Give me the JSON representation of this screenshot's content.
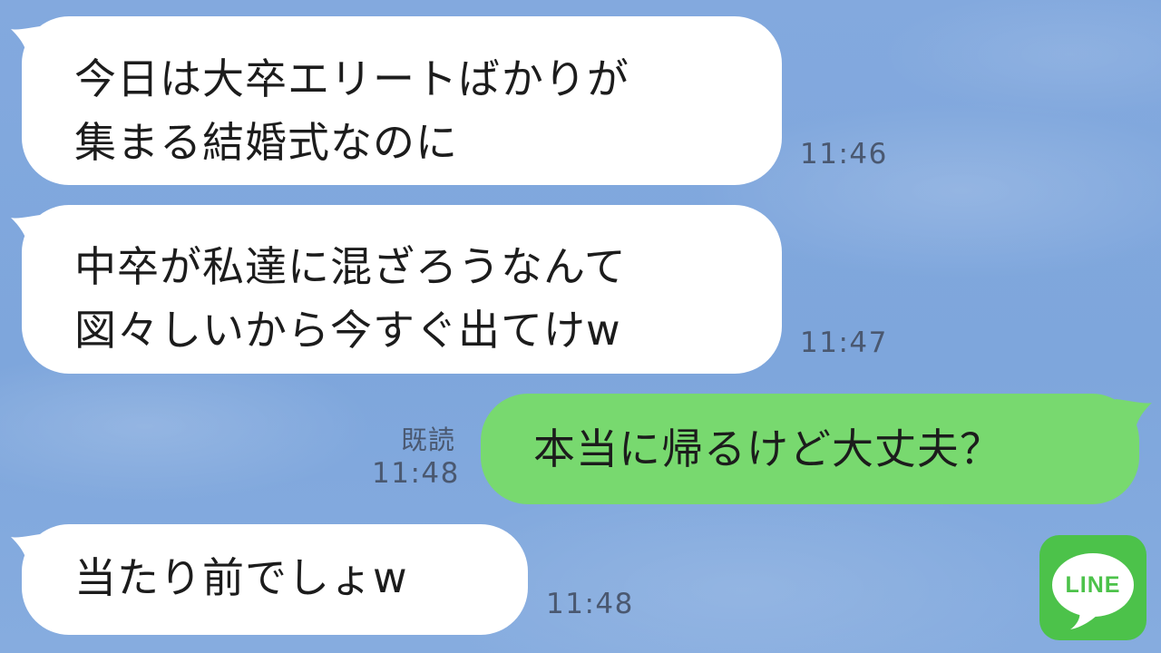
{
  "messages": [
    {
      "direction": "incoming",
      "lines": [
        "今日は大卒エリートばかりが",
        "集まる結婚式なのに"
      ],
      "time": "11:46"
    },
    {
      "direction": "incoming",
      "lines": [
        "中卒が私達に混ざろうなんて",
        "図々しいから今すぐ出てけw"
      ],
      "time": "11:47"
    },
    {
      "direction": "outgoing",
      "lines": [
        "本当に帰るけど大丈夫？"
      ],
      "read_label": "既読",
      "time": "11:48"
    },
    {
      "direction": "incoming",
      "lines": [
        "当たり前でしょw"
      ],
      "time": "11:48"
    }
  ],
  "logo": {
    "text": "LINE",
    "icon": "line-app-icon"
  },
  "colors": {
    "background": "#80a8dd",
    "incoming_bubble": "#ffffff",
    "outgoing_bubble": "#78d96f",
    "logo_green": "#4cc24a",
    "timestamp": "#4a5870"
  }
}
